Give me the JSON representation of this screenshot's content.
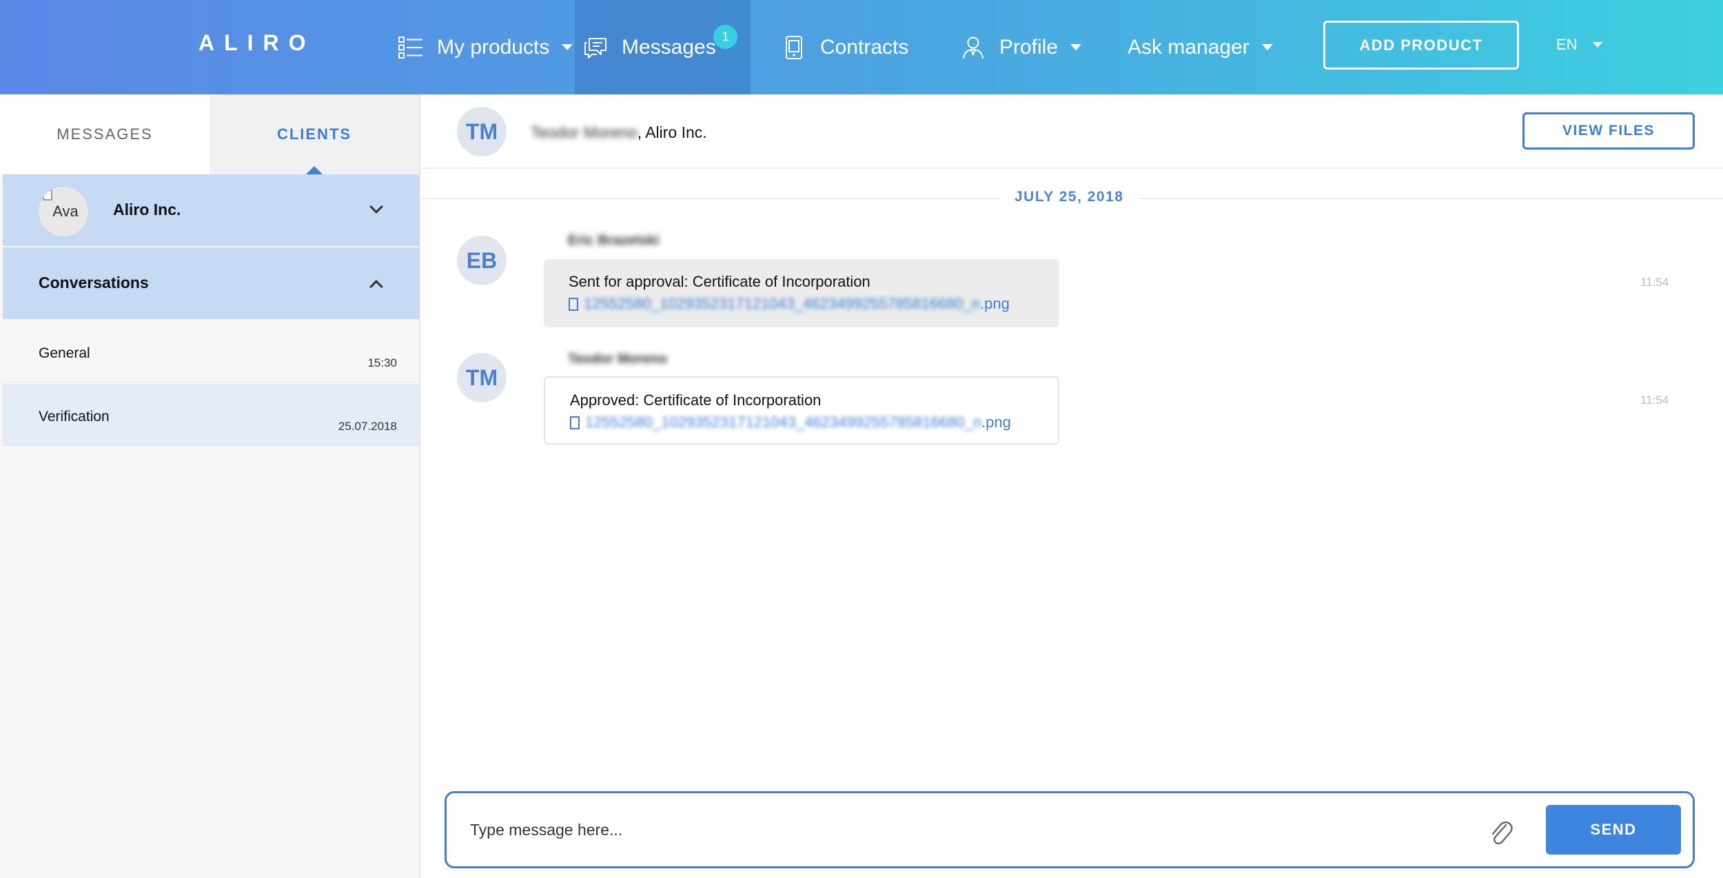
{
  "header": {
    "logo": "ALIRO",
    "nav": {
      "products": "My products",
      "messages": "Messages",
      "messages_badge": "1",
      "contracts": "Contracts",
      "profile": "Profile",
      "ask_manager": "Ask manager"
    },
    "add_product": "ADD PRODUCT",
    "language": "EN"
  },
  "sidebar": {
    "tabs": [
      {
        "label": "MESSAGES",
        "active": false
      },
      {
        "label": "CLIENTS",
        "active": true
      }
    ],
    "client": {
      "avatar_alt": "Ava",
      "name": "Aliro Inc."
    },
    "conversations_label": "Conversations",
    "conversations": [
      {
        "name": "General",
        "time": "15:30",
        "active": false
      },
      {
        "name": "Verification",
        "time": "25.07.2018",
        "active": true
      }
    ]
  },
  "chat": {
    "header": {
      "avatar_initials": "TM",
      "participant_name": "Teodor Moreno",
      "company": ", Aliro Inc.",
      "view_files": "VIEW FILES"
    },
    "date_label": "JULY 25, 2018",
    "messages": [
      {
        "initials": "EB",
        "sender": "Eric Brazetski",
        "text": "Sent for approval: Certificate of Incorporation",
        "file_name": "12552580_1029352317121043_4623499255785816680_n",
        "file_ext": ".png",
        "time": "11:54"
      },
      {
        "initials": "TM",
        "sender": "Teodor Moreno",
        "text": "Approved: Certificate of Incorporation",
        "file_name": "12552580_1029352317121043_4623499255785816680_n",
        "file_ext": ".png",
        "time": "11:54"
      }
    ]
  },
  "composer": {
    "placeholder": "Type message here...",
    "send": "SEND"
  },
  "colors": {
    "accent": "#3d7fd6",
    "header_gradient_start": "#5b87e6",
    "header_gradient_end": "#3dd0e0",
    "selected_row": "#c6daf3"
  }
}
